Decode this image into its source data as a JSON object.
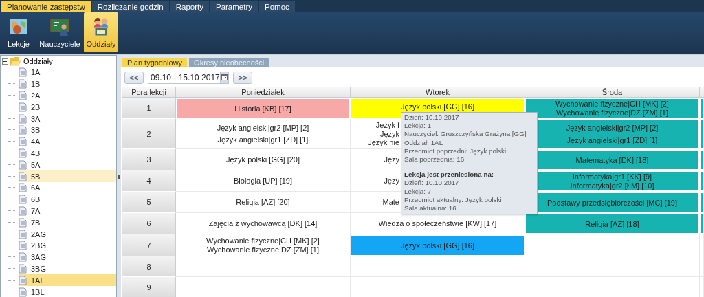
{
  "menu_tabs": [
    {
      "label": "Planowanie zastępstw",
      "selected": true
    },
    {
      "label": "Rozliczanie godzin",
      "selected": false
    },
    {
      "label": "Raporty",
      "selected": false
    },
    {
      "label": "Parametry",
      "selected": false
    },
    {
      "label": "Pomoc",
      "selected": false
    }
  ],
  "ribbon": [
    {
      "label": "Lekcje",
      "kind": "map",
      "selected": false
    },
    {
      "label": "Nauczyciele",
      "kind": "board",
      "selected": false
    },
    {
      "label": "Oddziały",
      "kind": "people",
      "selected": true
    }
  ],
  "tree": {
    "label": "Oddziały",
    "expanded": true,
    "children": [
      {
        "label": "1A",
        "selected": false,
        "hovered": false
      },
      {
        "label": "1B",
        "selected": false,
        "hovered": false
      },
      {
        "label": "2A",
        "selected": false,
        "hovered": false
      },
      {
        "label": "2B",
        "selected": false,
        "hovered": false
      },
      {
        "label": "3A",
        "selected": false,
        "hovered": false
      },
      {
        "label": "3B",
        "selected": false,
        "hovered": false
      },
      {
        "label": "4A",
        "selected": false,
        "hovered": false
      },
      {
        "label": "4B",
        "selected": false,
        "hovered": false
      },
      {
        "label": "5A",
        "selected": false,
        "hovered": false
      },
      {
        "label": "5B",
        "selected": false,
        "hovered": true
      },
      {
        "label": "6A",
        "selected": false,
        "hovered": false
      },
      {
        "label": "6B",
        "selected": false,
        "hovered": false
      },
      {
        "label": "7A",
        "selected": false,
        "hovered": false
      },
      {
        "label": "7B",
        "selected": false,
        "hovered": false
      },
      {
        "label": "2AG",
        "selected": false,
        "hovered": false
      },
      {
        "label": "2BG",
        "selected": false,
        "hovered": false
      },
      {
        "label": "3AG",
        "selected": false,
        "hovered": false
      },
      {
        "label": "3BG",
        "selected": false,
        "hovered": false
      },
      {
        "label": "1AL",
        "selected": true,
        "hovered": false
      },
      {
        "label": "1BL",
        "selected": false,
        "hovered": false
      }
    ]
  },
  "view_tabs": [
    {
      "label": "Plan tygodniowy",
      "selected": true
    },
    {
      "label": "Okresy nieobecności",
      "selected": false
    }
  ],
  "toolbar": {
    "prev": "<<",
    "date_range": "09.10 - 15.10 2017",
    "next": ">>"
  },
  "table": {
    "columns": [
      "Pora lekcji",
      "Poniedziałek",
      "Wtorek",
      "Środa"
    ],
    "rows": [
      {
        "cells": [
          {
            "kind": "number",
            "lines": [
              "1"
            ]
          },
          {
            "lines": [
              "Historia [KB] [17]"
            ],
            "color": "#f7a9a8"
          },
          {
            "lines": [
              "Język polski [GG] [16]"
            ],
            "color": "#ffff00"
          },
          {
            "lines": [
              "Wychowanie fizyczne|CH [MK] [2]",
              "Wychowanie fizyczne|DZ [ZM] [1]"
            ],
            "color": "#17b3b0"
          },
          {
            "color": "#17b3b0"
          }
        ]
      },
      {
        "cells": [
          {
            "kind": "number",
            "lines": [
              "2"
            ]
          },
          {
            "lines": [
              "Język angielski|gr2 [MP] [2]",
              "Język angielski|gr1 [ZD] [1]"
            ]
          },
          {
            "lines": [
              "Język f",
              "Język",
              "Język nie"
            ],
            "cut": true
          },
          {
            "lines": [
              "Język angielski|gr2 [MP] [2]",
              "Język angielski|gr1 [ZD] [1]"
            ],
            "color": "#17b3b0"
          },
          {
            "color": "#17b3b0"
          }
        ]
      },
      {
        "cells": [
          {
            "kind": "number",
            "lines": [
              "3"
            ]
          },
          {
            "lines": [
              "Język polski [GG] [20]"
            ]
          },
          {
            "lines": [
              "Języ"
            ],
            "cut": true
          },
          {
            "lines": [
              "Matematyka [DK] [18]"
            ],
            "color": "#17b3b0"
          },
          {
            "color": "#17b3b0"
          }
        ]
      },
      {
        "cells": [
          {
            "kind": "number",
            "lines": [
              "4"
            ]
          },
          {
            "lines": [
              "Biologia [UP] [19]"
            ]
          },
          {
            "lines": [
              "Języ"
            ],
            "cut": true
          },
          {
            "lines": [
              "Informatyka|gr1 [KK] [9]",
              "Informatyka|gr2 [ŁM] [10]"
            ],
            "color": "#17b3b0"
          },
          {
            "color": "#17b3b0"
          }
        ]
      },
      {
        "cells": [
          {
            "kind": "number",
            "lines": [
              "5"
            ]
          },
          {
            "lines": [
              "Religia [AZ] [20]"
            ]
          },
          {
            "lines": [
              "Mate"
            ],
            "cut": true
          },
          {
            "lines": [
              "Podstawy przedsiębiorczości [MC] [19]"
            ],
            "color": "#17b3b0"
          },
          {
            "color": "#17b3b0"
          }
        ]
      },
      {
        "cells": [
          {
            "kind": "number",
            "lines": [
              "6"
            ]
          },
          {
            "lines": [
              "Zajęcia z wychowawcą [DK] [14]"
            ]
          },
          {
            "lines": [
              "Wiedza o społeczeństwie [KW] [17]"
            ]
          },
          {
            "lines": [
              "Religia [AZ] [18]"
            ],
            "color": "#17b3b0"
          },
          {
            "color": "#17b3b0"
          }
        ]
      },
      {
        "cells": [
          {
            "kind": "number",
            "lines": [
              "7"
            ]
          },
          {
            "lines": [
              "Wychowanie fizyczne|CH [MK] [2]",
              "Wychowanie fizyczne|DZ [ZM] [1]"
            ]
          },
          {
            "lines": [
              "Język polski [GG] [16]"
            ],
            "color": "#12a6f4"
          },
          {},
          {}
        ]
      },
      {
        "cells": [
          {
            "kind": "number",
            "lines": [
              "8"
            ]
          },
          {},
          {},
          {},
          {}
        ]
      },
      {
        "cells": [
          {
            "kind": "number",
            "lines": [
              "9"
            ]
          },
          {},
          {},
          {},
          {}
        ]
      }
    ]
  },
  "tooltip": {
    "lines": [
      "Dzień: 10.10.2017",
      "Lekcja: 1",
      "Nauczyciel: Gruszczyńska Grażyna [GG]",
      "Oddział: 1AL",
      "Przedmiot poprzedni: Język polski",
      "Sala poprzednia: 16"
    ],
    "heading": "Lekcja jest przeniesiona na:",
    "lines_after": [
      "Dzień: 10.10.2017",
      "Lekcja: 7",
      "Przedmiot aktualny: Język polski",
      "Sala aktualna: 16"
    ]
  }
}
